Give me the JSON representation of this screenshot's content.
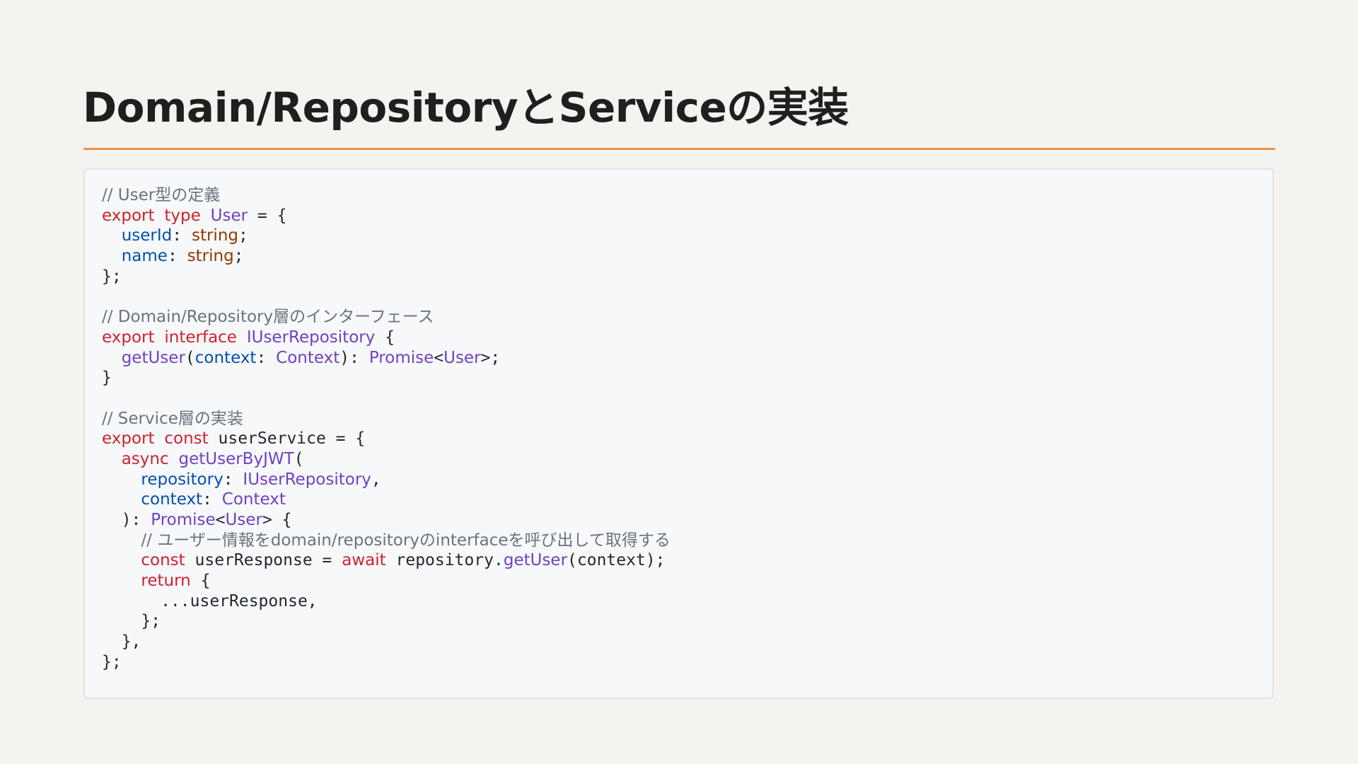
{
  "slide": {
    "title": "Domain/RepositoryとServiceの実装"
  },
  "colors": {
    "background": "#f5f3ef",
    "accent_rule": "#e8954a",
    "code_background": "#f6f8fa",
    "comment": "#6a737d",
    "keyword": "#cf222e",
    "type": "#6f42c1",
    "property": "#0550ae",
    "builtin": "#953800",
    "plain": "#24292e"
  },
  "code": {
    "language": "typescript",
    "lines": [
      [
        [
          "comment",
          "// User型の定義"
        ]
      ],
      [
        [
          "keyword",
          "export"
        ],
        [
          "plain",
          " "
        ],
        [
          "keyword",
          "type"
        ],
        [
          "plain",
          " "
        ],
        [
          "type",
          "User"
        ],
        [
          "plain",
          " = {"
        ]
      ],
      [
        [
          "plain",
          "  "
        ],
        [
          "prop",
          "userId"
        ],
        [
          "plain",
          ": "
        ],
        [
          "builtin",
          "string"
        ],
        [
          "plain",
          ";"
        ]
      ],
      [
        [
          "plain",
          "  "
        ],
        [
          "prop",
          "name"
        ],
        [
          "plain",
          ": "
        ],
        [
          "builtin",
          "string"
        ],
        [
          "plain",
          ";"
        ]
      ],
      [
        [
          "plain",
          "};"
        ]
      ],
      [],
      [
        [
          "comment",
          "// Domain/Repository層のインターフェース"
        ]
      ],
      [
        [
          "keyword",
          "export"
        ],
        [
          "plain",
          " "
        ],
        [
          "keyword",
          "interface"
        ],
        [
          "plain",
          " "
        ],
        [
          "type",
          "IUserRepository"
        ],
        [
          "plain",
          " {"
        ]
      ],
      [
        [
          "plain",
          "  "
        ],
        [
          "func",
          "getUser"
        ],
        [
          "plain",
          "("
        ],
        [
          "prop",
          "context"
        ],
        [
          "plain",
          ": "
        ],
        [
          "type",
          "Context"
        ],
        [
          "plain",
          "): "
        ],
        [
          "type",
          "Promise"
        ],
        [
          "plain",
          "<"
        ],
        [
          "type",
          "User"
        ],
        [
          "plain",
          ">;"
        ]
      ],
      [
        [
          "plain",
          "}"
        ]
      ],
      [],
      [
        [
          "comment",
          "// Service層の実装"
        ]
      ],
      [
        [
          "keyword",
          "export"
        ],
        [
          "plain",
          " "
        ],
        [
          "keyword",
          "const"
        ],
        [
          "plain",
          " userService = {"
        ]
      ],
      [
        [
          "plain",
          "  "
        ],
        [
          "keyword",
          "async"
        ],
        [
          "plain",
          " "
        ],
        [
          "func",
          "getUserByJWT"
        ],
        [
          "plain",
          "("
        ]
      ],
      [
        [
          "plain",
          "    "
        ],
        [
          "prop",
          "repository"
        ],
        [
          "plain",
          ": "
        ],
        [
          "type",
          "IUserRepository"
        ],
        [
          "plain",
          ","
        ]
      ],
      [
        [
          "plain",
          "    "
        ],
        [
          "prop",
          "context"
        ],
        [
          "plain",
          ": "
        ],
        [
          "type",
          "Context"
        ]
      ],
      [
        [
          "plain",
          "  ): "
        ],
        [
          "type",
          "Promise"
        ],
        [
          "plain",
          "<"
        ],
        [
          "type",
          "User"
        ],
        [
          "plain",
          "> {"
        ]
      ],
      [
        [
          "plain",
          "    "
        ],
        [
          "comment",
          "// ユーザー情報をdomain/repositoryのinterfaceを呼び出して取得する"
        ]
      ],
      [
        [
          "plain",
          "    "
        ],
        [
          "keyword",
          "const"
        ],
        [
          "plain",
          " userResponse = "
        ],
        [
          "keyword",
          "await"
        ],
        [
          "plain",
          " repository."
        ],
        [
          "func",
          "getUser"
        ],
        [
          "plain",
          "(context);"
        ]
      ],
      [
        [
          "plain",
          "    "
        ],
        [
          "keyword",
          "return"
        ],
        [
          "plain",
          " {"
        ]
      ],
      [
        [
          "plain",
          "      ...userResponse,"
        ]
      ],
      [
        [
          "plain",
          "    };"
        ]
      ],
      [
        [
          "plain",
          "  },"
        ]
      ],
      [
        [
          "plain",
          "};"
        ]
      ]
    ]
  }
}
